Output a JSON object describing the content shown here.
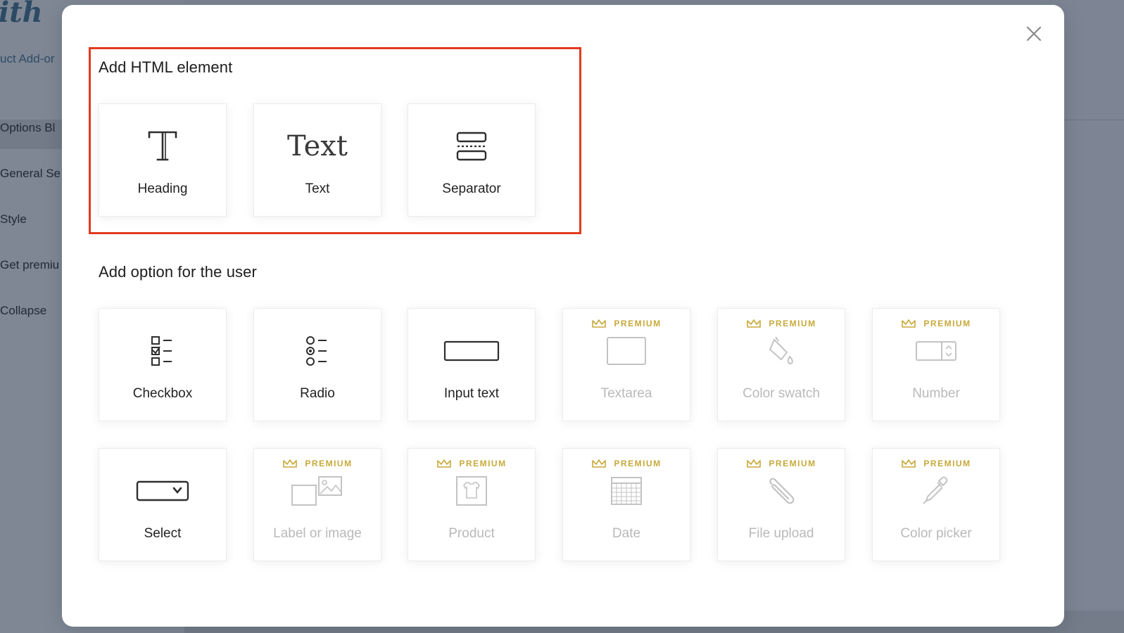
{
  "background": {
    "logo_text": "ith",
    "subtitle": "uct Add-or",
    "nav": [
      "Options Bl",
      "General Se",
      "Style",
      "Get premiu",
      "Collapse"
    ]
  },
  "modal": {
    "close_icon": "close-icon",
    "html_section": {
      "title": "Add HTML element",
      "items": [
        {
          "label": "Heading",
          "icon": "heading-icon"
        },
        {
          "label": "Text",
          "icon": "text-icon",
          "icon_glyph": "Text"
        },
        {
          "label": "Separator",
          "icon": "separator-icon"
        }
      ]
    },
    "option_section": {
      "title": "Add option for the user",
      "premium_badge": "PREMIUM",
      "items": [
        {
          "label": "Checkbox",
          "icon": "checkbox-icon",
          "premium": false
        },
        {
          "label": "Radio",
          "icon": "radio-icon",
          "premium": false
        },
        {
          "label": "Input text",
          "icon": "input-text-icon",
          "premium": false
        },
        {
          "label": "Textarea",
          "icon": "textarea-icon",
          "premium": true
        },
        {
          "label": "Color swatch",
          "icon": "color-swatch-icon",
          "premium": true
        },
        {
          "label": "Number",
          "icon": "number-icon",
          "premium": true
        },
        {
          "label": "Select",
          "icon": "select-icon",
          "premium": false
        },
        {
          "label": "Label or image",
          "icon": "label-image-icon",
          "premium": true
        },
        {
          "label": "Product",
          "icon": "product-icon",
          "premium": true
        },
        {
          "label": "Date",
          "icon": "date-icon",
          "premium": true
        },
        {
          "label": "File upload",
          "icon": "file-upload-icon",
          "premium": true
        },
        {
          "label": "Color picker",
          "icon": "color-picker-icon",
          "premium": true
        }
      ]
    }
  },
  "colors": {
    "highlight": "#e23a1e",
    "premium_gold": "#c8a93a",
    "overlay": "#7d8594"
  }
}
